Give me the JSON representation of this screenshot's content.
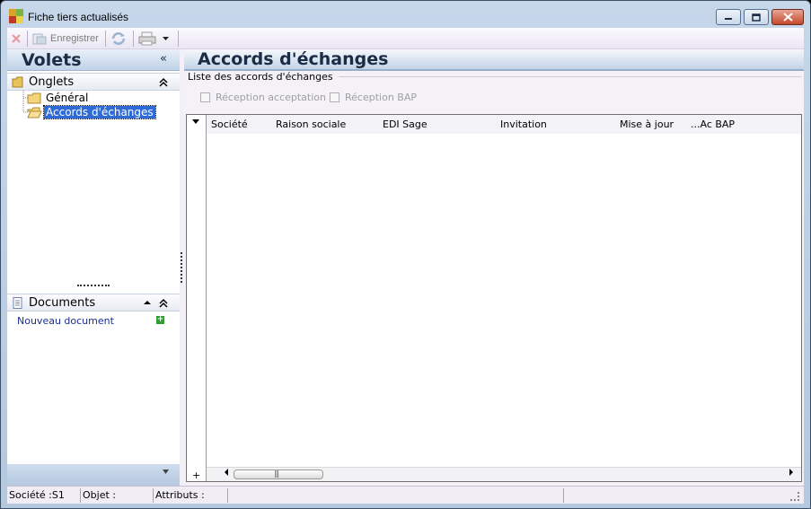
{
  "window": {
    "title": "Fiche tiers actualisés",
    "colors": {
      "titlebar": "#c6d7ea",
      "close_button": "#c4482c",
      "selection": "#2f6bd6",
      "link": "#1c2f8f"
    }
  },
  "toolbar": {
    "delete_icon": "delete-x-icon",
    "save_label": "Enregistrer",
    "refresh_icon": "refresh-icon",
    "print_icon": "printer-icon"
  },
  "left_panel": {
    "title": "Volets",
    "collapse_glyph": "«",
    "onglets": {
      "title": "Onglets",
      "items": [
        {
          "label": "Général",
          "selected": false
        },
        {
          "label": "Accords d'échanges",
          "selected": true
        }
      ]
    },
    "documents": {
      "title": "Documents",
      "new_document_label": "Nouveau document"
    }
  },
  "main": {
    "page_title": "Accords d'échanges",
    "group_label": "Liste des accords d'échanges",
    "checkboxes": [
      {
        "label": "Réception acceptation",
        "checked": false,
        "enabled": false
      },
      {
        "label": "Réception BAP",
        "checked": false,
        "enabled": false
      }
    ],
    "grid": {
      "columns": [
        "Société",
        "Raison sociale",
        "EDI Sage",
        "Invitation",
        "Mise à jour",
        "...Ac BAP"
      ],
      "rows": []
    }
  },
  "statusbar": {
    "societe": "Société :S1",
    "objet": "Objet :",
    "attributs": "Attributs :"
  }
}
